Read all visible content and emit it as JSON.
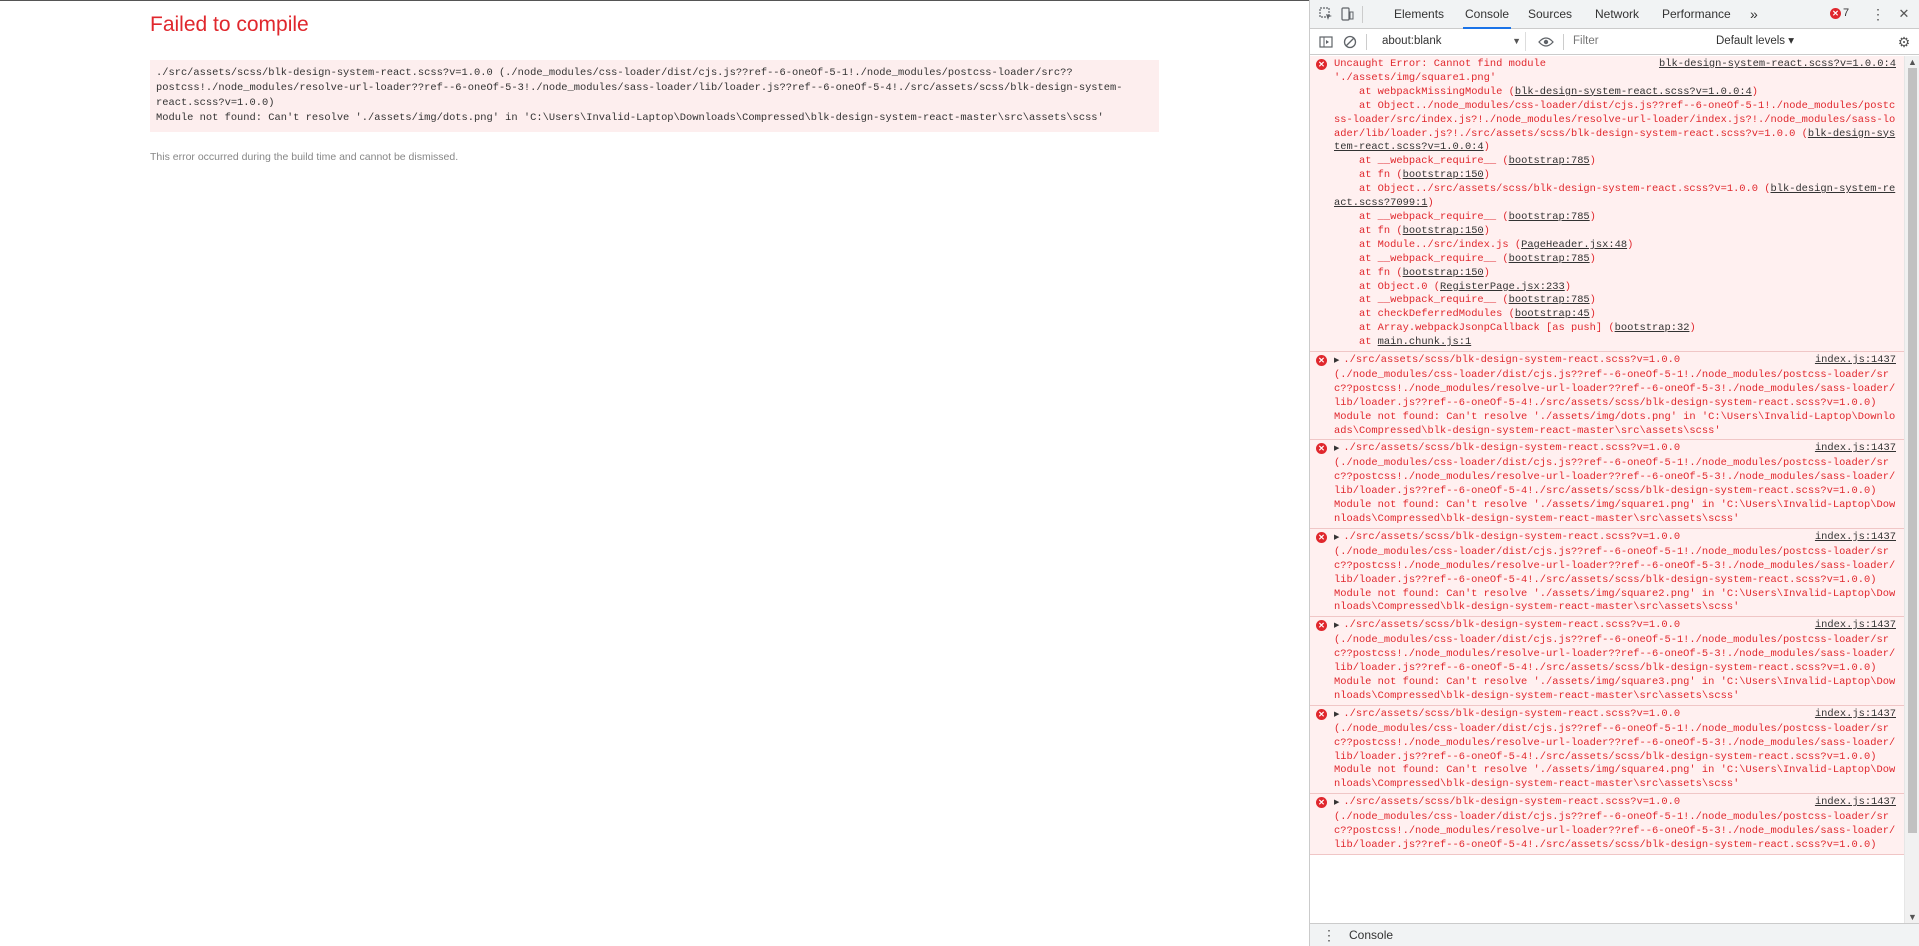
{
  "page": {
    "title": "Failed to compile",
    "error_lines": [
      "./src/assets/scss/blk-design-system-react.scss?v=1.0.0 (./node_modules/css-loader/dist/cjs.js??ref--6-oneOf-5-1!./node_modules/postcss-loader/src??",
      "postcss!./node_modules/resolve-url-loader??ref--6-oneOf-5-3!./node_modules/sass-loader/lib/loader.js??ref--6-oneOf-5-4!./src/assets/scss/blk-design-system-",
      "react.scss?v=1.0.0)",
      "Module not found: Can't resolve './assets/img/dots.png' in 'C:\\Users\\Invalid-Laptop\\Downloads\\Compressed\\blk-design-system-react-master\\src\\assets\\scss'"
    ],
    "note": "This error occurred during the build time and cannot be dismissed."
  },
  "devtools": {
    "tabs": [
      "Elements",
      "Console",
      "Sources",
      "Network",
      "Performance"
    ],
    "active_tab": "Console",
    "more_tabs": "»",
    "error_count": "7",
    "context": "about:blank",
    "filter_placeholder": "Filter",
    "levels": "Default levels ▾",
    "drawer_tab": "Console",
    "colors": {
      "error": "#e0272d",
      "error_bg": "#fff0f0",
      "accent": "#1a73e8"
    }
  },
  "console": {
    "first": {
      "source": "blk-design-system-react.scss?v=1.0.0:4",
      "lines": [
        "Uncaught Error: Cannot find module",
        "'./assets/img/square1.png'"
      ],
      "stack": [
        {
          "pre": "    at webpackMissingModule (",
          "link": "blk-design-system-react.scss?v=1.0.0:4",
          "post": ")"
        },
        {
          "pre": "    at Object../node_modules/css-loader/dist/cjs.js??ref--6-oneOf-5-1!./node_modules/postcss-loader/src/index.js?!./node_modules/resolve-url-loader/index.js?!./node_modules/sass-loader/lib/loader.js?!./src/assets/scss/blk-design-system-react.scss?v=1.0.0 (",
          "link": "blk-design-system-react.scss?v=1.0.0:4",
          "post": ")"
        },
        {
          "pre": "    at __webpack_require__ (",
          "link": "bootstrap:785",
          "post": ")"
        },
        {
          "pre": "    at fn (",
          "link": "bootstrap:150",
          "post": ")"
        },
        {
          "pre": "    at Object../src/assets/scss/blk-design-system-react.scss?v=1.0.0 (",
          "link": "blk-design-system-react.scss?7099:1",
          "post": ")"
        },
        {
          "pre": "    at __webpack_require__ (",
          "link": "bootstrap:785",
          "post": ")"
        },
        {
          "pre": "    at fn (",
          "link": "bootstrap:150",
          "post": ")"
        },
        {
          "pre": "    at Module../src/index.js (",
          "link": "PageHeader.jsx:48",
          "post": ")"
        },
        {
          "pre": "    at __webpack_require__ (",
          "link": "bootstrap:785",
          "post": ")"
        },
        {
          "pre": "    at fn (",
          "link": "bootstrap:150",
          "post": ")"
        },
        {
          "pre": "    at Object.0 (",
          "link": "RegisterPage.jsx:233",
          "post": ")"
        },
        {
          "pre": "    at __webpack_require__ (",
          "link": "bootstrap:785",
          "post": ")"
        },
        {
          "pre": "    at checkDeferredModules (",
          "link": "bootstrap:45",
          "post": ")"
        },
        {
          "pre": "    at Array.webpackJsonpCallback [as push] (",
          "link": "bootstrap:32",
          "post": ")"
        },
        {
          "pre": "    at ",
          "link": "main.chunk.js:1",
          "post": ""
        }
      ]
    },
    "grouped": [
      {
        "source": "index.js:1437",
        "head": "./src/assets/scss/blk-design-system-react.scss?v=1.0.0",
        "body": "(./node_modules/css-loader/dist/cjs.js??ref--6-oneOf-5-1!./node_modules/postcss-loader/src??postcss!./node_modules/resolve-url-loader??ref--6-oneOf-5-3!./node_modules/sass-loader/lib/loader.js??ref--6-oneOf-5-4!./src/assets/scss/blk-design-system-react.scss?v=1.0.0)\nModule not found: Can't resolve './assets/img/dots.png' in 'C:\\Users\\Invalid-Laptop\\Downloads\\Compressed\\blk-design-system-react-master\\src\\assets\\scss'"
      },
      {
        "source": "index.js:1437",
        "head": "./src/assets/scss/blk-design-system-react.scss?v=1.0.0",
        "body": "(./node_modules/css-loader/dist/cjs.js??ref--6-oneOf-5-1!./node_modules/postcss-loader/src??postcss!./node_modules/resolve-url-loader??ref--6-oneOf-5-3!./node_modules/sass-loader/lib/loader.js??ref--6-oneOf-5-4!./src/assets/scss/blk-design-system-react.scss?v=1.0.0)\nModule not found: Can't resolve './assets/img/square1.png' in 'C:\\Users\\Invalid-Laptop\\Downloads\\Compressed\\blk-design-system-react-master\\src\\assets\\scss'"
      },
      {
        "source": "index.js:1437",
        "head": "./src/assets/scss/blk-design-system-react.scss?v=1.0.0",
        "body": "(./node_modules/css-loader/dist/cjs.js??ref--6-oneOf-5-1!./node_modules/postcss-loader/src??postcss!./node_modules/resolve-url-loader??ref--6-oneOf-5-3!./node_modules/sass-loader/lib/loader.js??ref--6-oneOf-5-4!./src/assets/scss/blk-design-system-react.scss?v=1.0.0)\nModule not found: Can't resolve './assets/img/square2.png' in 'C:\\Users\\Invalid-Laptop\\Downloads\\Compressed\\blk-design-system-react-master\\src\\assets\\scss'"
      },
      {
        "source": "index.js:1437",
        "head": "./src/assets/scss/blk-design-system-react.scss?v=1.0.0",
        "body": "(./node_modules/css-loader/dist/cjs.js??ref--6-oneOf-5-1!./node_modules/postcss-loader/src??postcss!./node_modules/resolve-url-loader??ref--6-oneOf-5-3!./node_modules/sass-loader/lib/loader.js??ref--6-oneOf-5-4!./src/assets/scss/blk-design-system-react.scss?v=1.0.0)\nModule not found: Can't resolve './assets/img/square3.png' in 'C:\\Users\\Invalid-Laptop\\Downloads\\Compressed\\blk-design-system-react-master\\src\\assets\\scss'"
      },
      {
        "source": "index.js:1437",
        "head": "./src/assets/scss/blk-design-system-react.scss?v=1.0.0",
        "body": "(./node_modules/css-loader/dist/cjs.js??ref--6-oneOf-5-1!./node_modules/postcss-loader/src??postcss!./node_modules/resolve-url-loader??ref--6-oneOf-5-3!./node_modules/sass-loader/lib/loader.js??ref--6-oneOf-5-4!./src/assets/scss/blk-design-system-react.scss?v=1.0.0)\nModule not found: Can't resolve './assets/img/square4.png' in 'C:\\Users\\Invalid-Laptop\\Downloads\\Compressed\\blk-design-system-react-master\\src\\assets\\scss'"
      },
      {
        "source": "index.js:1437",
        "head": "./src/assets/scss/blk-design-system-react.scss?v=1.0.0",
        "body": "(./node_modules/css-loader/dist/cjs.js??ref--6-oneOf-5-1!./node_modules/postcss-loader/src??postcss!./node_modules/resolve-url-loader??ref--6-oneOf-5-3!./node_modules/sass-loader/lib/loader.js??ref--6-oneOf-5-4!./src/assets/scss/blk-design-system-react.scss?v=1.0.0)"
      }
    ]
  }
}
